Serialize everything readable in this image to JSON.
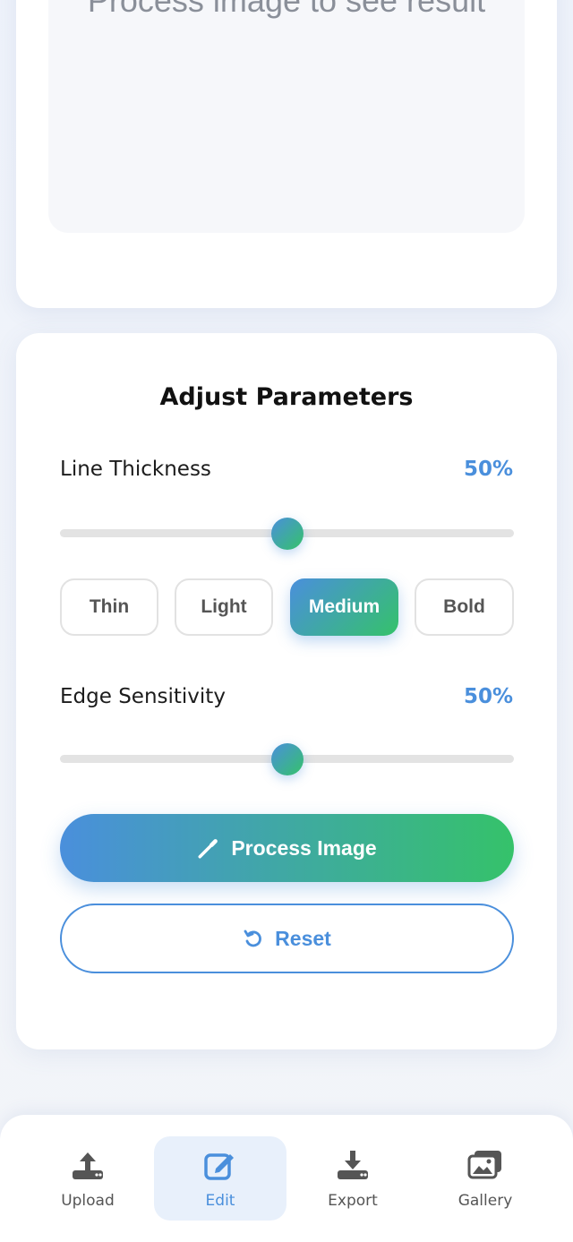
{
  "preview": {
    "placeholder": "Process image to see result"
  },
  "params": {
    "title": "Adjust Parameters",
    "line_thickness": {
      "label": "Line Thickness",
      "value_text": "50%",
      "level": 0.5
    },
    "presets": [
      {
        "label": "Thin",
        "active": false
      },
      {
        "label": "Light",
        "active": false
      },
      {
        "label": "Medium",
        "active": true
      },
      {
        "label": "Bold",
        "active": false
      }
    ],
    "edge_sensitivity": {
      "label": "Edge Sensitivity",
      "value_text": "50%",
      "level": 0.5
    },
    "process_button": "Process Image",
    "reset_button": "Reset"
  },
  "nav": {
    "items": [
      {
        "label": "Upload",
        "icon": "upload-icon",
        "active": false
      },
      {
        "label": "Edit",
        "icon": "edit-icon",
        "active": true
      },
      {
        "label": "Export",
        "icon": "download-icon",
        "active": false
      },
      {
        "label": "Gallery",
        "icon": "gallery-icon",
        "active": false
      }
    ]
  },
  "colors": {
    "accent_blue": "#4a8fdc",
    "accent_green": "#35c26a"
  }
}
